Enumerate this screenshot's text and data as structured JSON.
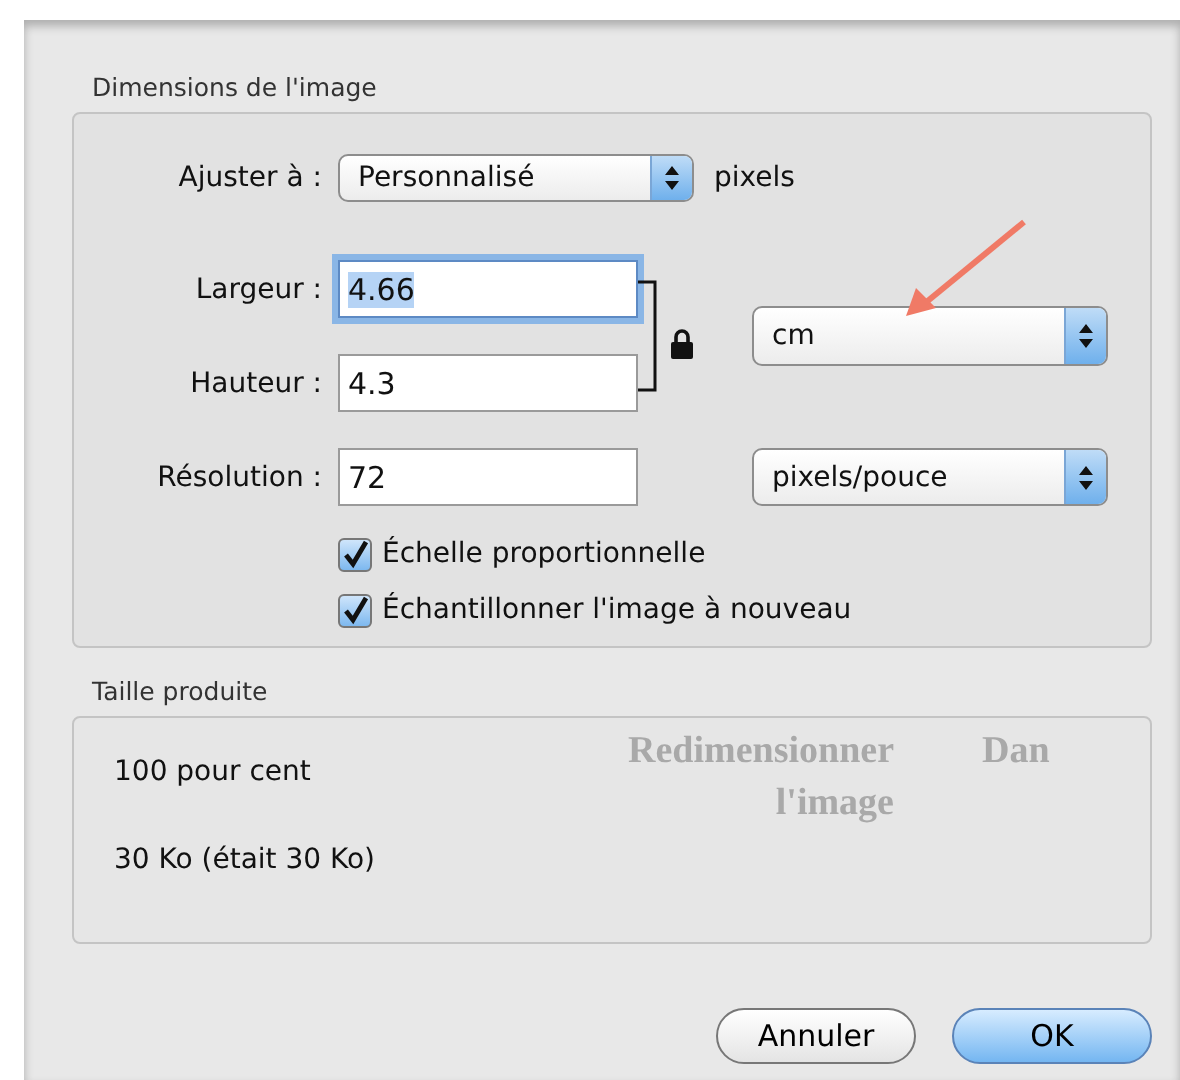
{
  "dimensions": {
    "title": "Dimensions de l'image",
    "fit": {
      "label": "Ajuster à :",
      "value": "Personnalisé",
      "unit": "pixels"
    },
    "fields": [
      {
        "label": "Largeur :",
        "value": "4.66",
        "focused": true
      },
      {
        "label": "Hauteur :",
        "value": "4.3",
        "focused": false
      }
    ],
    "size_unit": "cm",
    "constrained": true,
    "resolution": {
      "label": "Résolution :",
      "value": "72",
      "unit": "pixels/pouce"
    },
    "checkboxes": [
      {
        "label": "Échelle proportionnelle",
        "checked": true
      },
      {
        "label": "Échantillonner l'image à nouveau",
        "checked": true
      }
    ]
  },
  "result": {
    "title": "Taille produite",
    "lines": [
      "100 pour cent",
      "30 Ko (était 30 Ko)"
    ]
  },
  "background_text": [
    "Redimensionner l'image",
    "Dan"
  ],
  "buttons": [
    {
      "label": "Annuler",
      "default": false
    },
    {
      "label": "OK",
      "default": true
    }
  ]
}
